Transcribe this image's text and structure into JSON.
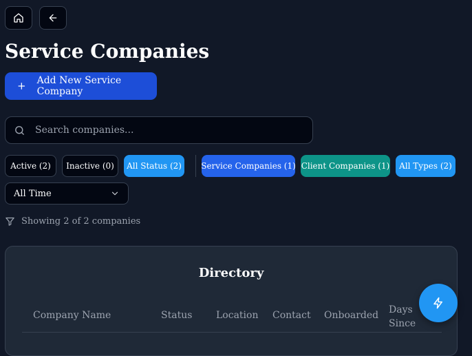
{
  "page": {
    "title": "Service Companies"
  },
  "nav": {
    "home_icon": "home-icon",
    "back_icon": "arrow-left-icon"
  },
  "actions": {
    "add_label": "Add New Service Company"
  },
  "search": {
    "placeholder": "Search companies..."
  },
  "filters": {
    "status": [
      {
        "label": "Active (2)",
        "selected": false
      },
      {
        "label": "Inactive (0)",
        "selected": false
      },
      {
        "label": "All Status (2)",
        "selected": true
      }
    ],
    "types": [
      {
        "label": "Service Companies (1)",
        "color": "#2563eb"
      },
      {
        "label": "Client Companies (1)",
        "color": "#0d9488"
      },
      {
        "label": "All Types (2)",
        "color": "#2196f3",
        "selected": true
      }
    ],
    "time": {
      "selected": "All Time"
    }
  },
  "results": {
    "summary": "Showing 2 of 2 companies"
  },
  "directory": {
    "title": "Directory",
    "columns": [
      "Company Name",
      "Status",
      "Location",
      "Contact",
      "Onboarded",
      "Days Since"
    ]
  },
  "colors": {
    "accent": "#2196f3",
    "primary": "#1d4ed8",
    "background": "#111827",
    "card": "#1f2937"
  }
}
